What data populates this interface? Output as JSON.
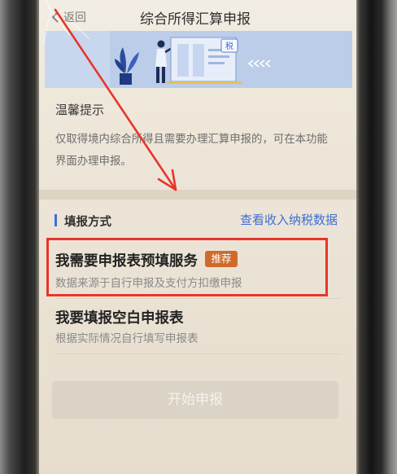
{
  "header": {
    "back_label": "返回",
    "title": "综合所得汇算申报"
  },
  "banner": {
    "badge_text": "税"
  },
  "notice": {
    "title": "温馨提示",
    "lines": [
      "仅取得境内综合所得且需要办理汇算申报的，可在本功能",
      "界面办理申报。"
    ]
  },
  "section": {
    "title": "填报方式",
    "link_label": "查看收入纳税数据"
  },
  "options": [
    {
      "title": "我需要申报表预填服务",
      "badge": "推荐",
      "description": "数据来源于自行申报及支付方扣缴申报"
    },
    {
      "title": "我要填报空白申报表",
      "description": "根据实际情况自行填写申报表"
    }
  ],
  "submit": {
    "label": "开始申报",
    "disabled": true
  },
  "icons": {
    "back": "chevron-left-icon",
    "banner_arrows": "chevrons-left-icon"
  },
  "colors": {
    "accent": "#3b6fd6",
    "badge": "#d06a2a",
    "annotation": "#e8352b",
    "screen_background": "#ece5d8"
  }
}
